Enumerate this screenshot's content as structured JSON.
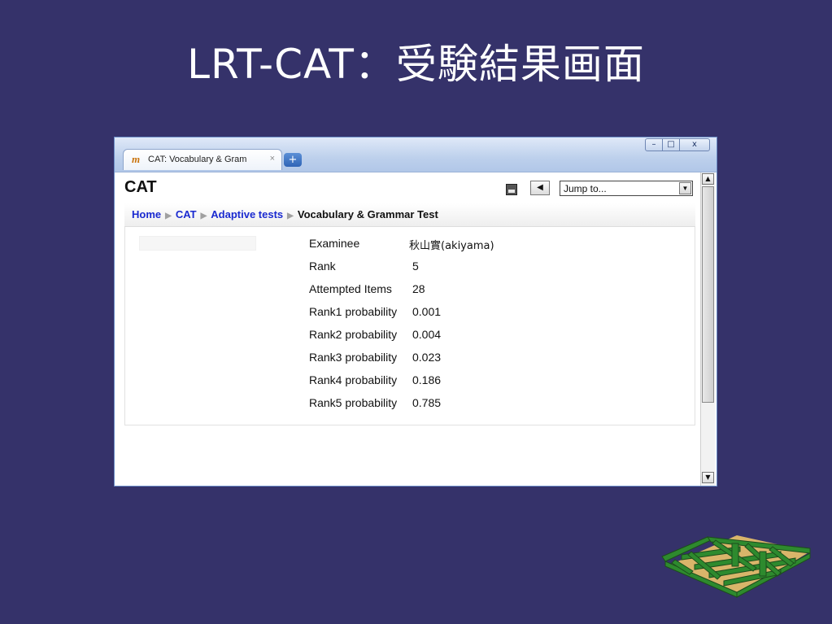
{
  "slide": {
    "title": "LRT-CAT：受験結果画面"
  },
  "browser": {
    "tab_icon": "moodle-icon",
    "tab_title": "CAT: Vocabulary & Gram",
    "tab_close": "×",
    "new_tab": "+",
    "minimize": "–",
    "maximize": "□",
    "close": "x"
  },
  "page": {
    "heading": "CAT",
    "back_button": "◀",
    "jump_to": {
      "value": "Jump to...",
      "arrow": "▼"
    }
  },
  "breadcrumb": {
    "items": [
      "Home",
      "CAT",
      "Adaptive tests",
      "Vocabulary & Grammar Test"
    ],
    "separator": "▶"
  },
  "results": {
    "rows": [
      {
        "label": "Examinee",
        "value": "秋山實(akiyama)"
      },
      {
        "label": "Rank",
        "value": "5"
      },
      {
        "label": "Attempted Items",
        "value": "28"
      },
      {
        "label": "Rank1 probability",
        "value": "0.001"
      },
      {
        "label": "Rank2 probability",
        "value": "0.004"
      },
      {
        "label": "Rank3 probability",
        "value": "0.023"
      },
      {
        "label": "Rank4 probability",
        "value": "0.186"
      },
      {
        "label": "Rank5 probability",
        "value": "0.785"
      }
    ]
  },
  "scrollbar": {
    "up": "▲",
    "down": "▼"
  },
  "colors": {
    "slide_background": "#35326a",
    "link": "#1a2ad0",
    "maze_green": "#2e8a2e",
    "maze_dark": "#1c4d1c",
    "maze_base": "#d9b56a"
  },
  "icons": [
    "moodle-icon",
    "report-icon",
    "maze-logo-icon"
  ]
}
